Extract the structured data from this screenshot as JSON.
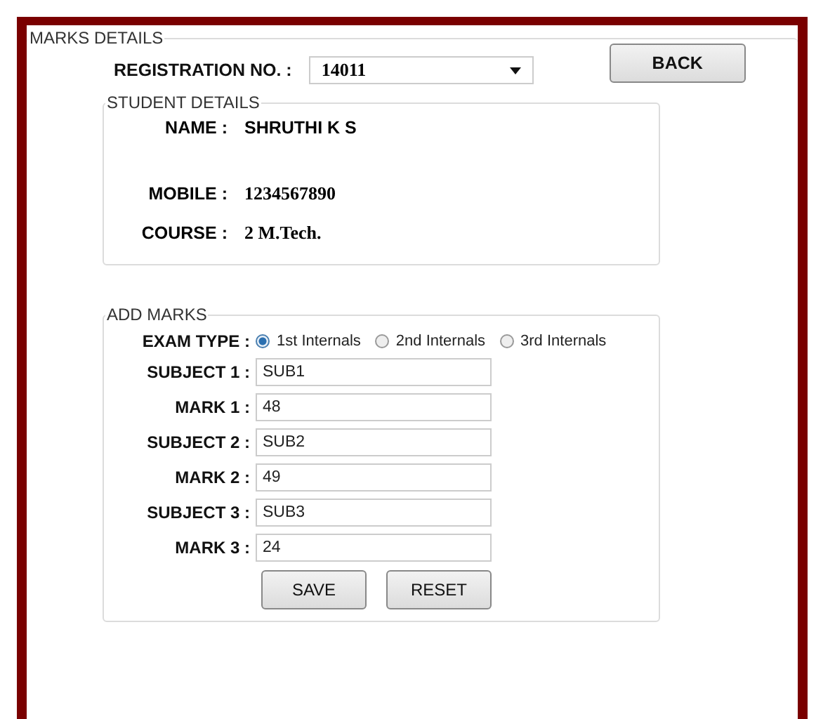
{
  "form": {
    "title": "MARKS DETAILS",
    "registration": {
      "label": "REGISTRATION NO. :",
      "value": "14011"
    },
    "back_button": "BACK",
    "student_details": {
      "title": "STUDENT DETAILS",
      "rows": [
        {
          "label": "NAME :",
          "value": "SHRUTHI K S",
          "kind": "sans"
        },
        {
          "label": "MOBILE :",
          "value": "1234567890",
          "kind": "serif"
        },
        {
          "label": "COURSE :",
          "value": "2 M.Tech.",
          "kind": "serif"
        }
      ]
    },
    "add_marks": {
      "title": "ADD MARKS",
      "exam_type": {
        "label": "EXAM TYPE :",
        "options": [
          {
            "label": "1st Internals",
            "selected": true
          },
          {
            "label": "2nd Internals",
            "selected": false
          },
          {
            "label": "3rd Internals",
            "selected": false
          }
        ]
      },
      "fields": [
        {
          "label": "SUBJECT 1 :",
          "value": "SUB1"
        },
        {
          "label": "MARK 1 :",
          "value": "48"
        },
        {
          "label": "SUBJECT 2 :",
          "value": "SUB2"
        },
        {
          "label": "MARK 2 :",
          "value": "49"
        },
        {
          "label": "SUBJECT 3 :",
          "value": "SUB3"
        },
        {
          "label": "MARK 3 :",
          "value": "24"
        }
      ],
      "buttons": [
        "SAVE",
        "RESET"
      ]
    }
  }
}
